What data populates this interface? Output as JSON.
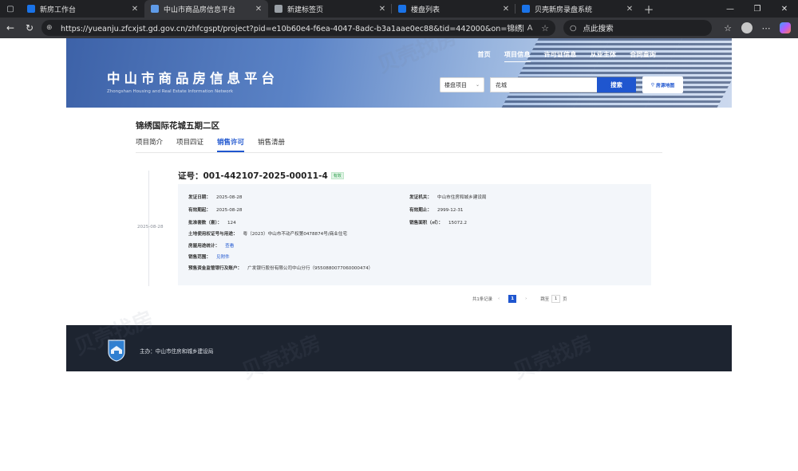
{
  "browser": {
    "tabs": [
      {
        "label": "新房工作台",
        "fav_color": "#1a73e8",
        "active": false
      },
      {
        "label": "中山市商品房信息平台",
        "fav_color": "#5f9be8",
        "active": true
      },
      {
        "label": "新建标签页",
        "fav_color": "#9aa0a6",
        "active": false
      },
      {
        "label": "楼盘列表",
        "fav_color": "#1a73e8",
        "active": false
      },
      {
        "label": "贝壳新房录盘系统",
        "fav_color": "#1a73e8",
        "active": false
      }
    ],
    "url": "https://yueanju.zfcxjst.gd.gov.cn/zhfcgspt/project?pid=e10b60e4-f6ea-4047-8adc-b3a1aae0ec88&tid=442000&on=锦绣国际花城五期二区",
    "search_placeholder": "点此搜索"
  },
  "site": {
    "title": "中山市商品房信息平台",
    "subtitle": "Zhongshan Housing and Real Estate Information Network",
    "nav": [
      "首页",
      "项目信息",
      "许可证信息",
      "从业主体",
      "合同查询"
    ],
    "nav_active": 1,
    "search": {
      "type": "楼盘项目",
      "keyword": "花城",
      "button": "搜索",
      "map_button": "房源地图"
    }
  },
  "project": {
    "name": "锦绣国际花城五期二区",
    "tabs": [
      "项目简介",
      "项目四证",
      "销售许可",
      "销售清册"
    ],
    "active_tab": 2
  },
  "permit": {
    "date": "2025-08-28",
    "number": "证号：001-442107-2025-00011-4",
    "status": "有效",
    "fields": {
      "issue_date_k": "发证日期：",
      "issue_date_v": "2025-08-28",
      "authority_k": "发证机关：",
      "authority_v": "中山市住房和城乡建设局",
      "valid_from_k": "有效期起：",
      "valid_from_v": "2025-08-28",
      "valid_to_k": "有效期止：",
      "valid_to_v": "2999-12-31",
      "units_k": "批准套数（套）：",
      "units_v": "124",
      "area_k": "销售面积（㎡）：",
      "area_v": "15072.2",
      "land_k": "土地使用权证号与用途：",
      "land_v": "粤（2023）中山市不动产权第0478874号/商业住宅",
      "usage_k": "房屋用途统计：",
      "usage_v": "查看",
      "scope_k": "销售范围：",
      "scope_v": "见附件",
      "account_k": "预售资金监管银行及账户：",
      "account_v": "广发银行股份有限公司中山分行（9550880077060000474）"
    }
  },
  "pager": {
    "total": "共1条记录",
    "current": "1",
    "goto_prefix": "跳至",
    "goto_value": "1",
    "goto_suffix": "页"
  },
  "footer": {
    "host": "主办：中山市住房和城乡建设局"
  },
  "watermark": "贝壳找房"
}
